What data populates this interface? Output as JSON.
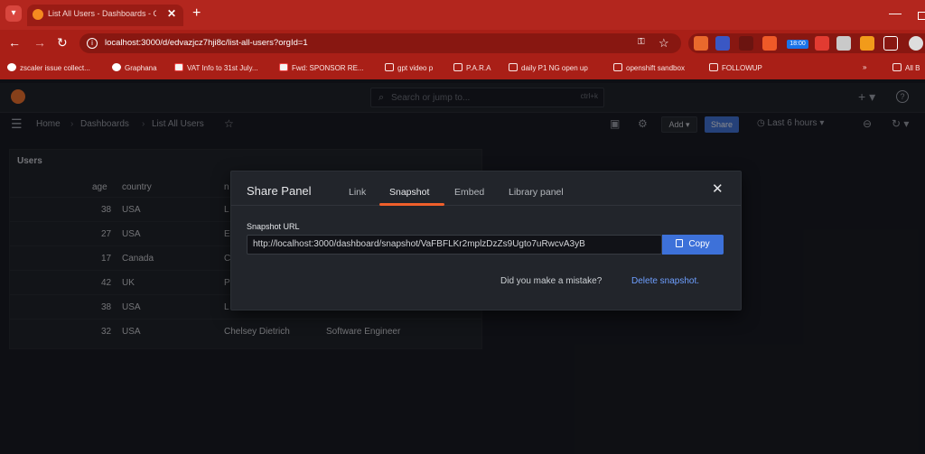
{
  "browser": {
    "tab_title": "List All Users - Dashboards - Gra",
    "url": "localhost:3000/d/edvazjcz7hji8c/list-all-users?orgId=1",
    "ext_badge": "18:00",
    "bookmarks": [
      "zscaler issue collect...",
      "Graphana",
      "VAT Info to 31st July...",
      "Fwd: SPONSOR RE...",
      "gpt video p",
      "P.A.R.A",
      "daily P1 NG  open up",
      "openshift sandbox",
      "FOLLOWUP",
      "All B"
    ]
  },
  "grafana": {
    "search_placeholder": "Search or jump to...",
    "search_shortcut": "ctrl+k",
    "breadcrumb": [
      "Home",
      "Dashboards",
      "List All Users"
    ],
    "add_label": "Add",
    "share_label": "Share",
    "time_range": "Last 6 hours"
  },
  "panel": {
    "title": "Users",
    "columns": [
      "age",
      "country",
      "n"
    ],
    "rows": [
      {
        "age": "38",
        "country": "USA",
        "name": "L",
        "role": ""
      },
      {
        "age": "27",
        "country": "USA",
        "name": "E",
        "role": ""
      },
      {
        "age": "17",
        "country": "Canada",
        "name": "C",
        "role": ""
      },
      {
        "age": "42",
        "country": "UK",
        "name": "P",
        "role": ""
      },
      {
        "age": "38",
        "country": "USA",
        "name": "L",
        "role": ""
      },
      {
        "age": "32",
        "country": "USA",
        "name": "Chelsey Dietrich",
        "role": "Software Engineer"
      }
    ]
  },
  "share_modal": {
    "title": "Share Panel",
    "tabs": [
      "Link",
      "Snapshot",
      "Embed",
      "Library panel"
    ],
    "active_tab": "Snapshot",
    "snapshot_label": "Snapshot URL",
    "snapshot_url": "http://localhost:3000/dashboard/snapshot/VaFBFLKr2mplzDzZs9Ugto7uRwcvA3yB",
    "copy_label": "Copy",
    "mistake_text": "Did you make a mistake?",
    "delete_label": "Delete snapshot."
  },
  "colors": {
    "browser_red": "#b3261e",
    "grafana_bg": "#111217",
    "accent_orange": "#f05f2b",
    "primary_blue": "#3d71d9",
    "link_blue": "#6e9fff"
  }
}
